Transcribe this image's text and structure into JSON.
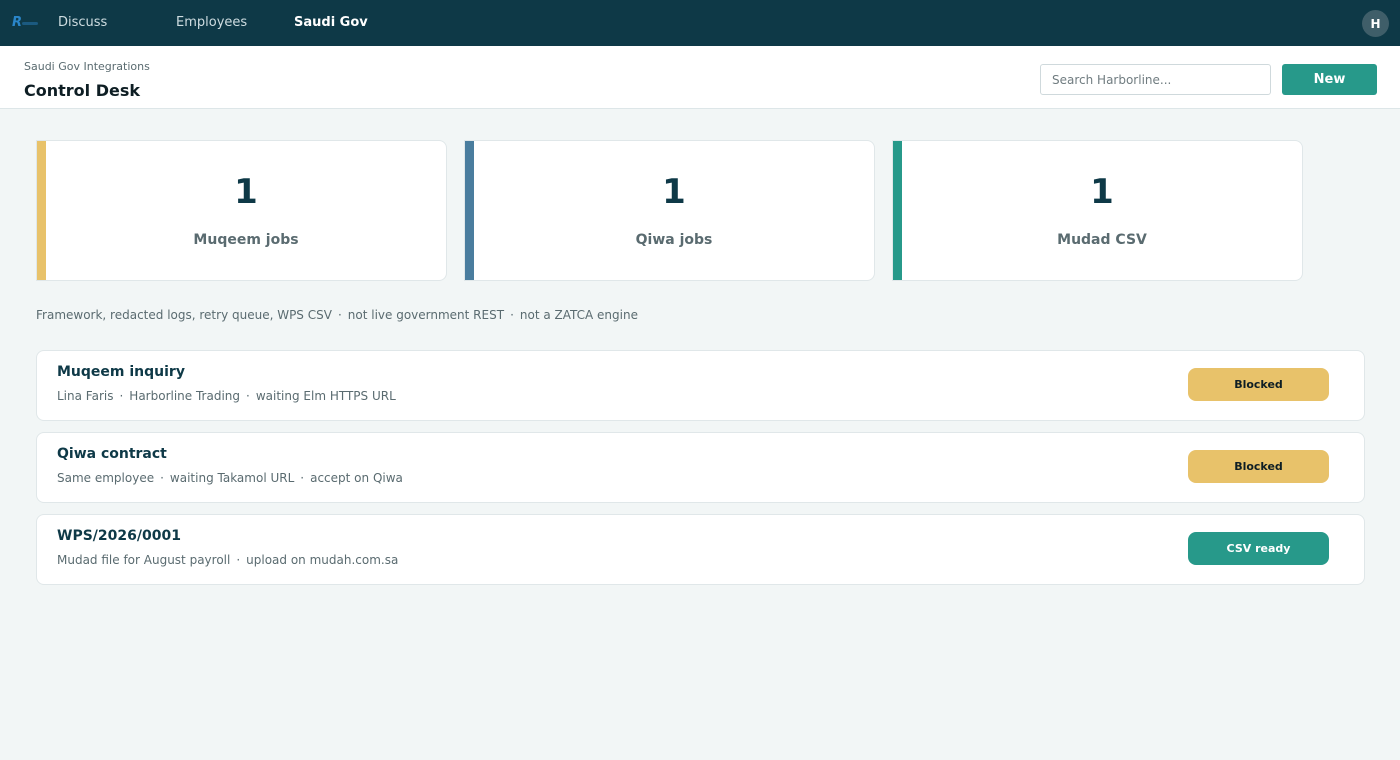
{
  "app": {
    "nav": [
      "Discuss",
      "Employees",
      "Saudi Gov"
    ],
    "active_nav": "Saudi Gov",
    "avatar_initial": "H",
    "logo_icon": "harborline-logo-icon"
  },
  "header": {
    "breadcrumb": "Saudi Gov Integrations",
    "title": "Control Desk",
    "search_placeholder": "Search Harborline...",
    "new_label": "New"
  },
  "stats": [
    {
      "value": "1",
      "label": "Muqeem jobs",
      "accent": "#e8c26a"
    },
    {
      "value": "1",
      "label": "Qiwa jobs",
      "accent": "#4a7d9e"
    },
    {
      "value": "1",
      "label": "Mudad CSV",
      "accent": "#27998a"
    }
  ],
  "summary": [
    "Framework, redacted logs, retry queue, WPS CSV",
    "not live government REST",
    "not a ZATCA engine"
  ],
  "jobs": [
    {
      "title": "Muqeem inquiry",
      "meta": [
        "Lina Faris",
        "Harborline Trading",
        "waiting Elm HTTPS URL"
      ],
      "status": "Blocked",
      "status_color": "#e8c26a",
      "status_text_color": "#0e1e24"
    },
    {
      "title": "Qiwa contract",
      "meta": [
        "Same employee",
        "waiting Takamol URL",
        "accept on Qiwa"
      ],
      "status": "Blocked",
      "status_color": "#e8c26a",
      "status_text_color": "#0e1e24"
    },
    {
      "title": "WPS/2026/0001",
      "meta": [
        "Mudad file for August payroll",
        "upload on mudah.com.sa"
      ],
      "status": "CSV ready",
      "status_color": "#27998a",
      "status_text_color": "#ffffff"
    }
  ],
  "separator": "·"
}
